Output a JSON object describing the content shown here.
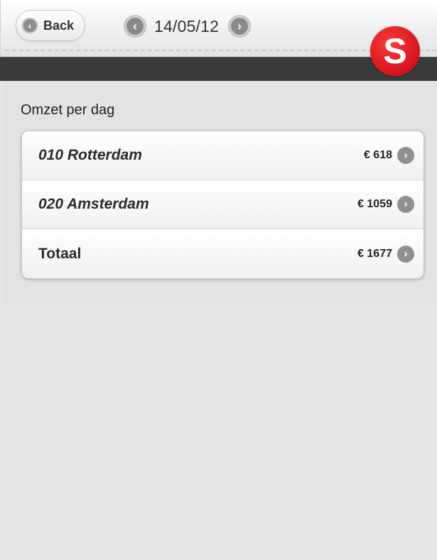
{
  "header": {
    "back_label": "Back",
    "back_icon": "chevron-left-icon",
    "date": "14/05/12",
    "prev_icon": "chevron-left-icon",
    "next_icon": "chevron-right-icon",
    "logo_letter": "S",
    "logo_color": "#d4141c"
  },
  "main": {
    "section_title": "Omzet per dag",
    "rows": [
      {
        "label": "010 Rotterdam",
        "value": "€ 618"
      },
      {
        "label": "020 Amsterdam",
        "value": "€ 1059"
      },
      {
        "label": "Totaal",
        "value": "€ 1677"
      }
    ]
  },
  "glyphs": {
    "left": "‹",
    "right": "›"
  }
}
